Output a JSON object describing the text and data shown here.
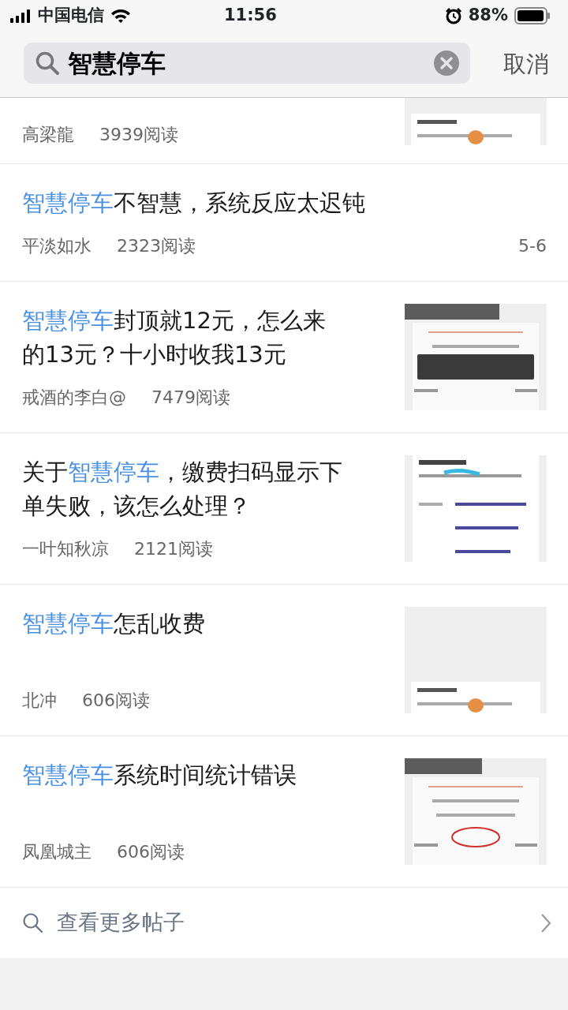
{
  "status_bar": {
    "carrier": "中国电信",
    "time": "11:56",
    "battery": "88%"
  },
  "search": {
    "value": "智慧停车",
    "cancel": "取消"
  },
  "posts": [
    {
      "author": "高梁龍",
      "reads": "3939阅读",
      "thumbnail": {
        "kind": "picture"
      },
      "partial": true
    },
    {
      "title": [
        {
          "text": "智慧停车",
          "kind": "keyword"
        },
        {
          "text": "不智慧，系统反应太迟钝",
          "kind": "plain"
        }
      ],
      "author": "平淡如水",
      "reads": "2323阅读",
      "pages": "5-6"
    },
    {
      "title": [
        {
          "text": "智慧停车",
          "kind": "keyword"
        },
        {
          "text": "封顶就12元，怎么来的13元？十小时收我13元",
          "kind": "plain"
        }
      ],
      "author": "戒酒的李白@",
      "reads": "7479阅读",
      "thumbnail": {
        "kind": "picture"
      }
    },
    {
      "title": [
        {
          "text": "关于",
          "kind": "plain"
        },
        {
          "text": "智慧停车",
          "kind": "keyword"
        },
        {
          "text": "，缴费扫码显示下单失败，该怎么处理？",
          "kind": "plain"
        }
      ],
      "author": "一叶知秋凉",
      "reads": "2121阅读",
      "thumbnail": {
        "kind": "picture"
      }
    },
    {
      "title": [
        {
          "text": "智慧停车",
          "kind": "keyword"
        },
        {
          "text": "怎乱收费",
          "kind": "plain"
        }
      ],
      "author": "北冲",
      "reads": "606阅读",
      "thumbnail": {
        "kind": "picture"
      }
    },
    {
      "title": [
        {
          "text": "智慧停车",
          "kind": "keyword"
        },
        {
          "text": "系统时间统计错误",
          "kind": "plain"
        }
      ],
      "author": "凤凰城主",
      "reads": "606阅读",
      "thumbnail": {
        "kind": "picture"
      }
    }
  ],
  "more": {
    "label": "查看更多帖子"
  }
}
